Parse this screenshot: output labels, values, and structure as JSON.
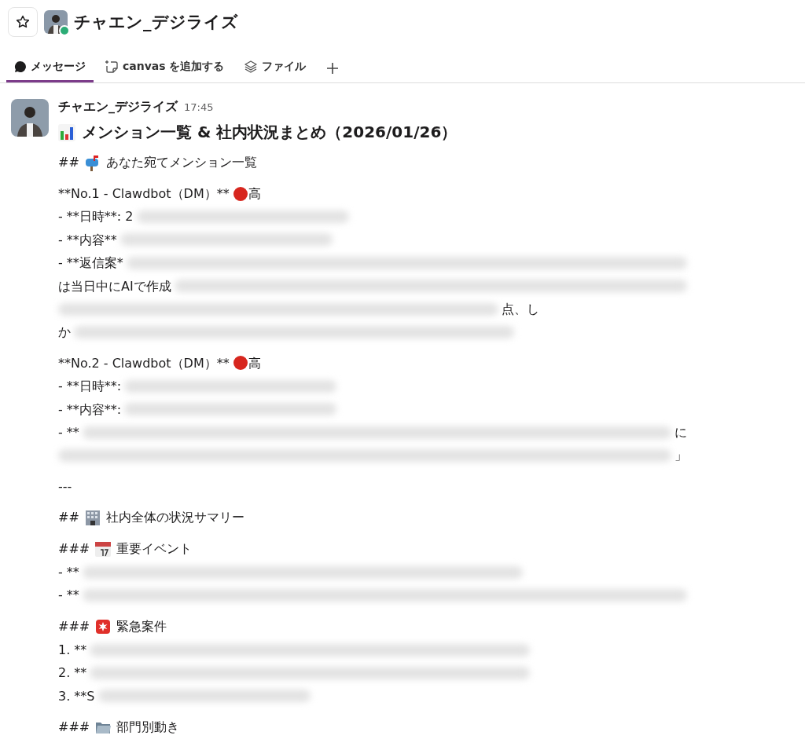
{
  "header": {
    "title": "チャエン_デジライズ",
    "online": true
  },
  "tabs": [
    {
      "label": "メッセージ",
      "selected": true,
      "kind": "messages"
    },
    {
      "label": "canvas を追加する",
      "selected": false,
      "kind": "canvas"
    },
    {
      "label": "ファイル",
      "selected": false,
      "kind": "files"
    }
  ],
  "message": {
    "author": "チャエン_デジライズ",
    "time": "17:45",
    "title": "メンション一覧 & 社内状況まとめ（2026/01/26）",
    "blocks": [
      {
        "kind": "heading",
        "marker": "##",
        "text": "あなた宛てメンション一覧"
      },
      {
        "kind": "priority",
        "text": "**No.1 - Clawdbot（DM）**",
        "level_text": "高"
      },
      {
        "kind": "medium",
        "text": "- **日時**: 2"
      },
      {
        "kind": "medium",
        "text": "- **内容**"
      },
      {
        "kind": "wide",
        "text": "- **返信案*"
      },
      {
        "kind": "wide",
        "text": "は当日中にAIで作成"
      },
      {
        "kind": "long",
        "suffix": "点、し"
      },
      {
        "kind": "long",
        "text": "か"
      },
      {
        "kind": "priority",
        "text": "**No.2 - Clawdbot（DM）**",
        "level_text": "高"
      },
      {
        "kind": "medium",
        "text": "- **日時**:"
      },
      {
        "kind": "medium",
        "text": "- **内容**:"
      },
      {
        "kind": "wide",
        "text": "- **",
        "suffix": "に"
      },
      {
        "kind": "wide",
        "suffix": "」"
      },
      {
        "kind": "rule",
        "text": "---"
      },
      {
        "kind": "heading",
        "marker": "##",
        "text": "社内全体の状況サマリー"
      },
      {
        "kind": "heading",
        "marker": "###",
        "text": "重要イベント"
      },
      {
        "kind": "long",
        "text": "- **"
      },
      {
        "kind": "wide",
        "text": "- **"
      },
      {
        "kind": "heading",
        "marker": "###",
        "text": "緊急案件"
      },
      {
        "kind": "long",
        "text": "1. **"
      },
      {
        "kind": "long",
        "text": "2. **"
      },
      {
        "kind": "medium",
        "text": "3. **S"
      },
      {
        "kind": "heading",
        "marker": "###",
        "text": "部門別動き"
      }
    ]
  }
}
